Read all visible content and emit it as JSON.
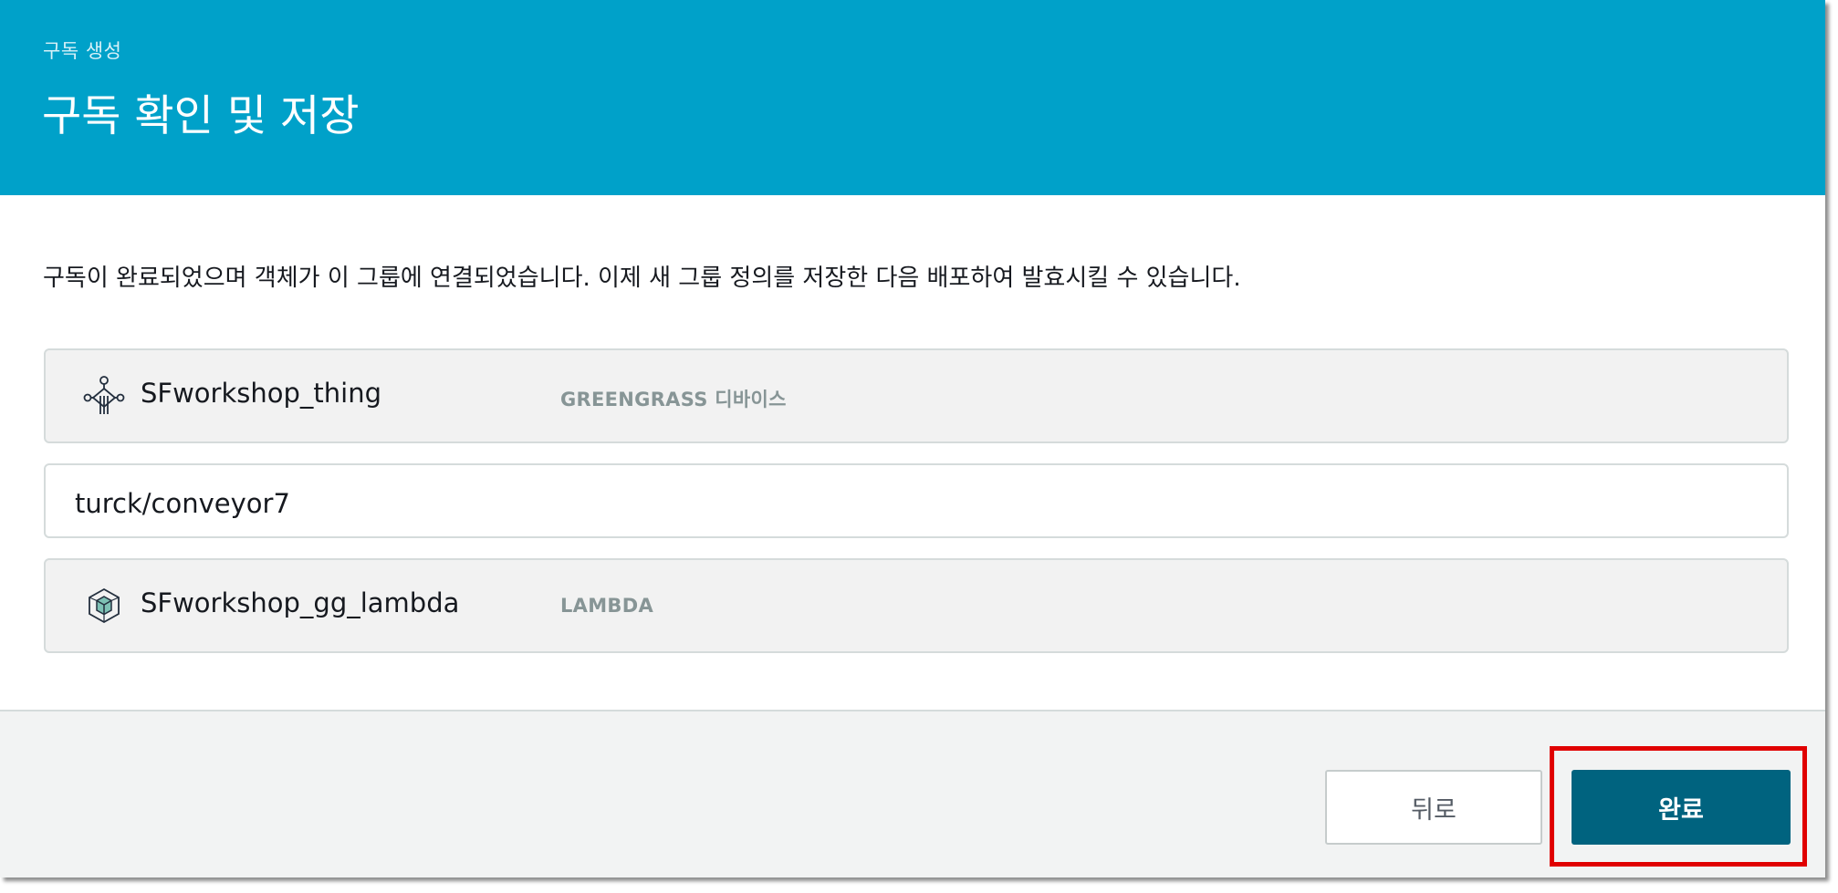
{
  "header": {
    "kicker": "구독 생성",
    "title": "구독 확인 및 저장",
    "background_color": "#00a1c9"
  },
  "description": "구독이 완료되었으며 객체가 이 그룹에 연결되었습니다. 이제 새 그룹 정의를 저장한 다음 배포하여 발효시킬 수 있습니다.",
  "subscription": {
    "source": {
      "icon": "greengrass-device-icon",
      "name": "SFworkshop_thing",
      "type": "GREENGRASS 디바이스"
    },
    "topic": "turck/conveyor7",
    "target": {
      "icon": "lambda-cube-icon",
      "name": "SFworkshop_gg_lambda",
      "type": "LAMBDA"
    }
  },
  "footer": {
    "back_label": "뒤로",
    "done_label": "완료",
    "primary_color": "#00637f",
    "highlight_color": "#e00000"
  }
}
